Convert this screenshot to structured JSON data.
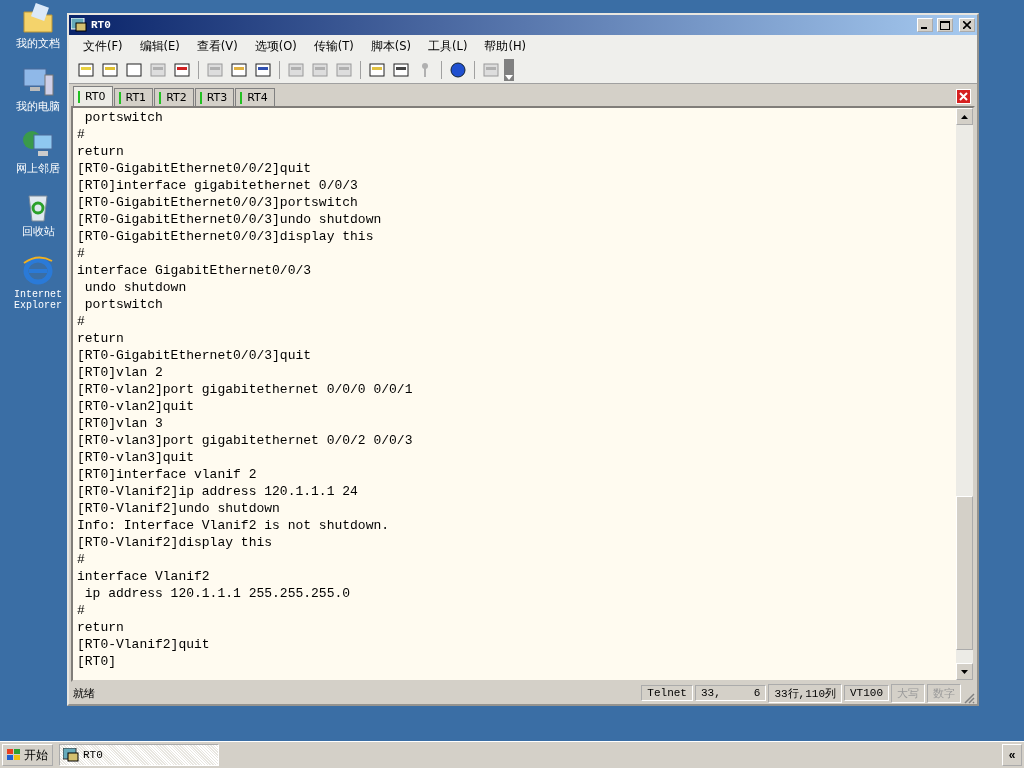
{
  "desktop_icons": [
    {
      "kind": "documents",
      "label": "我的文档"
    },
    {
      "kind": "computer",
      "label": "我的电脑"
    },
    {
      "kind": "network",
      "label": "网上邻居"
    },
    {
      "kind": "recycle",
      "label": "回收站"
    },
    {
      "kind": "ie",
      "label": "Internet Explorer"
    }
  ],
  "window": {
    "title": "RT0"
  },
  "menu": [
    "文件(F)",
    "编辑(E)",
    "查看(V)",
    "选项(O)",
    "传输(T)",
    "脚本(S)",
    "工具(L)",
    "帮助(H)"
  ],
  "toolbar_groups": [
    [
      {
        "disabled": false
      },
      {
        "disabled": false
      },
      {
        "disabled": false
      },
      {
        "disabled": true
      },
      {
        "disabled": false
      }
    ],
    [
      {
        "disabled": true
      },
      {
        "disabled": false
      },
      {
        "disabled": false
      }
    ],
    [
      {
        "disabled": true
      },
      {
        "disabled": true
      },
      {
        "disabled": true
      }
    ],
    [
      {
        "disabled": false
      },
      {
        "disabled": false
      },
      {
        "disabled": true
      }
    ],
    [
      {
        "disabled": false
      }
    ],
    [
      {
        "disabled": true
      }
    ]
  ],
  "tabs": [
    {
      "label": "RT0",
      "selected": true
    },
    {
      "label": "RT1",
      "selected": false
    },
    {
      "label": "RT2",
      "selected": false
    },
    {
      "label": "RT3",
      "selected": false
    },
    {
      "label": "RT4",
      "selected": false
    }
  ],
  "terminal_lines": [
    " portswitch",
    "#",
    "return",
    "[RT0-GigabitEthernet0/0/2]quit",
    "[RT0]interface gigabitethernet 0/0/3",
    "[RT0-GigabitEthernet0/0/3]portswitch",
    "[RT0-GigabitEthernet0/0/3]undo shutdown",
    "[RT0-GigabitEthernet0/0/3]display this",
    "#",
    "interface GigabitEthernet0/0/3",
    " undo shutdown",
    " portswitch",
    "#",
    "return",
    "[RT0-GigabitEthernet0/0/3]quit",
    "[RT0]vlan 2",
    "[RT0-vlan2]port gigabitethernet 0/0/0 0/0/1",
    "[RT0-vlan2]quit",
    "[RT0]vlan 3",
    "[RT0-vlan3]port gigabitethernet 0/0/2 0/0/3",
    "[RT0-vlan3]quit",
    "[RT0]interface vlanif 2",
    "[RT0-Vlanif2]ip address 120.1.1.1 24",
    "[RT0-Vlanif2]undo shutdown",
    "Info: Interface Vlanif2 is not shutdown.",
    "[RT0-Vlanif2]display this",
    "#",
    "interface Vlanif2",
    " ip address 120.1.1.1 255.255.255.0",
    "#",
    "return",
    "[RT0-Vlanif2]quit",
    "[RT0]"
  ],
  "status_bar": {
    "message": "就绪",
    "panes": [
      {
        "text": "Telnet",
        "disabled": false
      },
      {
        "text": "33,     6",
        "disabled": false
      },
      {
        "text": "33行,110列",
        "disabled": false
      },
      {
        "text": "VT100",
        "disabled": false
      },
      {
        "text": "大写",
        "disabled": true
      },
      {
        "text": "数字",
        "disabled": true
      }
    ]
  },
  "taskbar": {
    "start": "开始",
    "tasks": [
      {
        "label": "RT0",
        "selected": true
      }
    ],
    "tray_toggle": "«"
  }
}
